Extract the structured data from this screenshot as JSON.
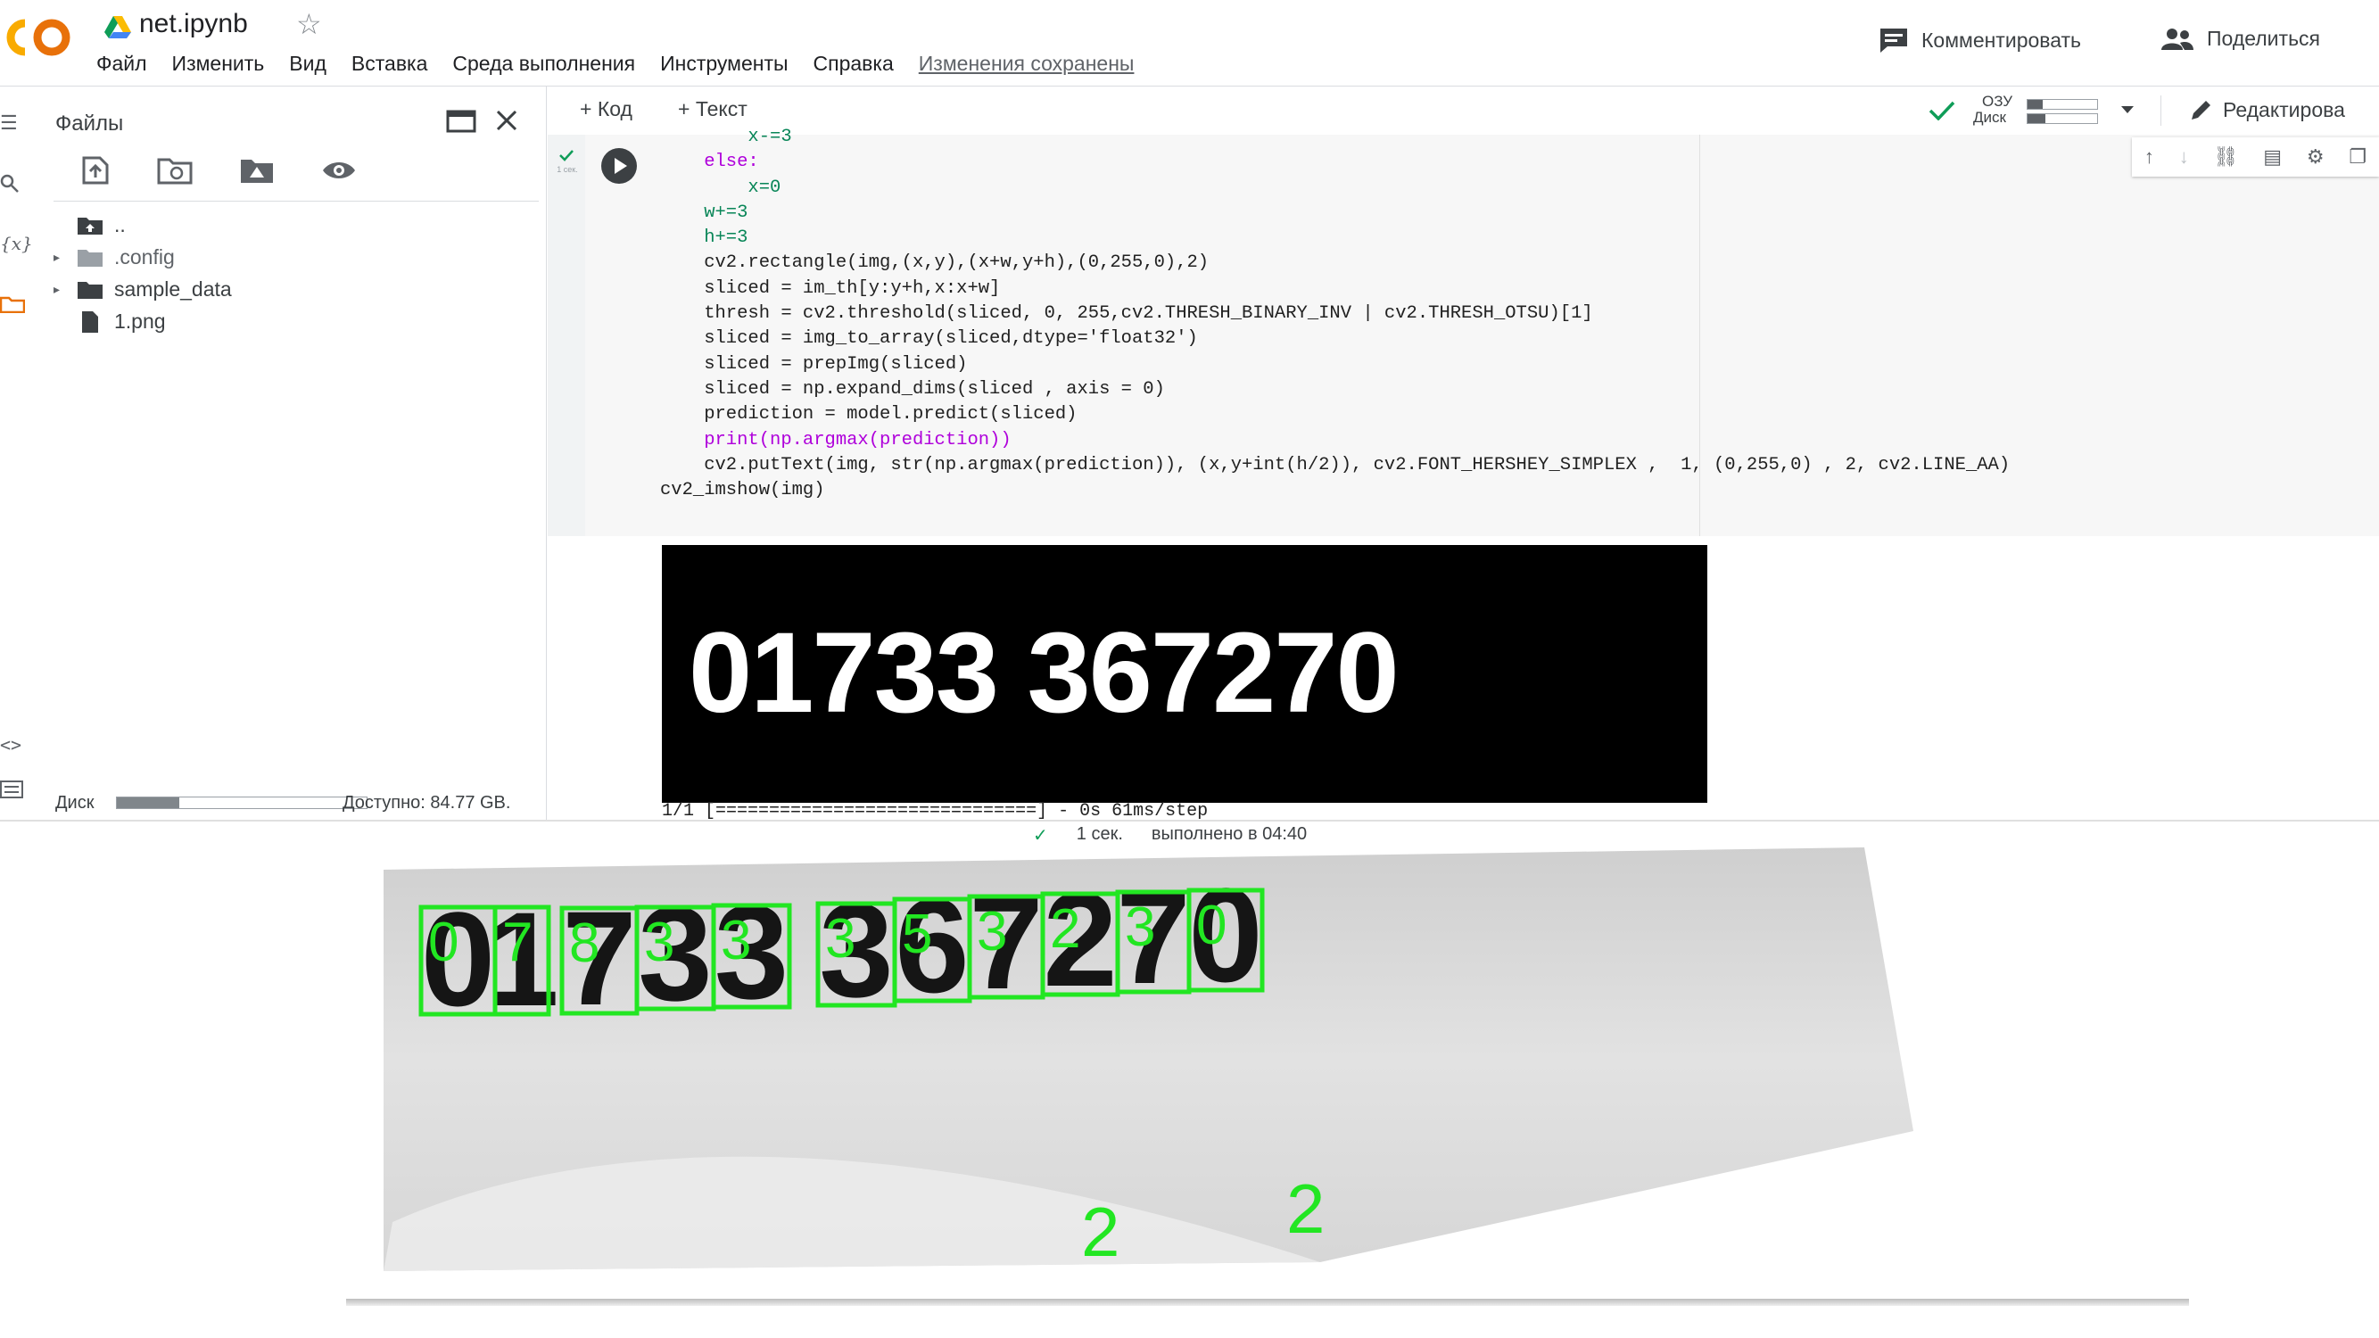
{
  "header": {
    "notebook_title": "net.ipynb",
    "menu": [
      "Файл",
      "Изменить",
      "Вид",
      "Вставка",
      "Среда выполнения",
      "Инструменты",
      "Справка"
    ],
    "saved_status": "Изменения сохранены",
    "comment_label": "Комментировать",
    "share_label": "Поделиться"
  },
  "files_panel": {
    "title": "Файлы",
    "tree": [
      {
        "label": ".."
      },
      {
        "label": ".config"
      },
      {
        "label": "sample_data"
      },
      {
        "label": "1.png"
      }
    ],
    "disk_label": "Диск",
    "disk_used_fraction": 0.25,
    "disk_free": "Доступно: 84.77 GB."
  },
  "toolbar": {
    "add_code": "+ Код",
    "add_text": "+ Текст",
    "ram_label": "ОЗУ",
    "disk_label": "Диск",
    "edit_label": "Редактирова"
  },
  "cell": {
    "exec_time": "1 сек.",
    "code_lines": [
      "        x-=3",
      "    else:",
      "        x=0",
      "    w+=3",
      "    h+=3",
      "    cv2.rectangle(img,(x,y),(x+w,y+h),(0,255,0),2)",
      "    sliced = im_th[y:y+h,x:x+w]",
      "    thresh = cv2.threshold(sliced, 0, 255,cv2.THRESH_BINARY_INV | cv2.THRESH_OTSU)[1]",
      "    sliced = img_to_array(sliced,dtype='float32')",
      "    sliced = prepImg(sliced)",
      "    sliced = np.expand_dims(sliced , axis = 0)",
      "    prediction = model.predict(sliced)",
      "    print(np.argmax(prediction))",
      "    cv2.putText(img, str(np.argmax(prediction)), (x,y+int(h/2)), cv2.FONT_HERSHEY_SIMPLEX ,  1, (0,255,0) , 2, cv2.LINE_AA)",
      "cv2_imshow(img)"
    ]
  },
  "output": {
    "image_text": "01733 367270",
    "progress_line": "1/1 [==============================] - 0s 61ms/step",
    "status_time": "1 сек.",
    "status_done": "выполнено в 04:40"
  },
  "bottom_image": {
    "digits": [
      "0",
      "1",
      "7",
      "3",
      "3",
      "3",
      "6",
      "7",
      "2",
      "7",
      "0"
    ],
    "predictions": [
      "0",
      "7",
      "8",
      "3",
      "3",
      "3",
      "5",
      "3",
      "2",
      "3",
      "0"
    ],
    "stray_labels": [
      "2",
      "2"
    ],
    "box_color": "#22e622"
  },
  "colors": {
    "logo_orange": "#f9ab00",
    "accent_green": "#0f9d58"
  }
}
